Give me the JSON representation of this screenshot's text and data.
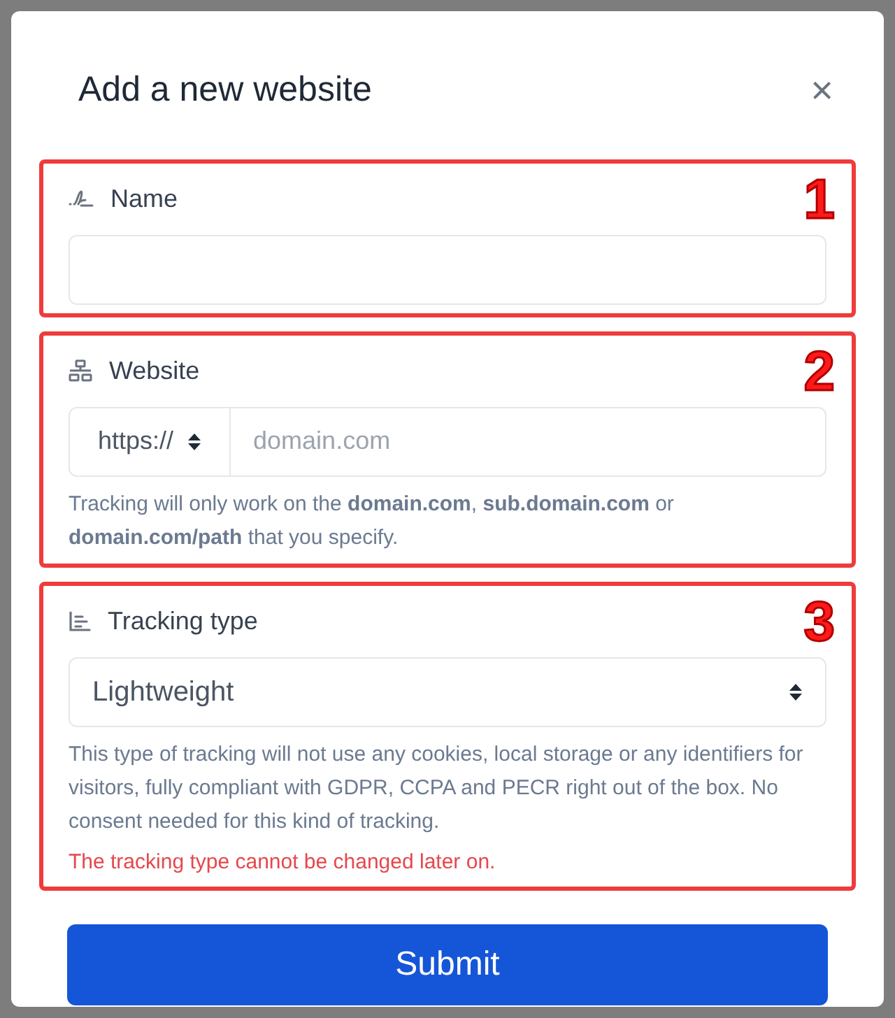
{
  "dialog": {
    "title": "Add a new website",
    "close": "×"
  },
  "sections": [
    {
      "number": "1",
      "kind": "text",
      "label": "Name"
    },
    {
      "number": "2",
      "kind": "url",
      "label": "Website",
      "protocol": "https://",
      "placeholder": "domain.com",
      "help": "Tracking will only work on the **domain.com**, **sub.domain.com** or **domain.com/path** that you specify."
    },
    {
      "number": "3",
      "kind": "select",
      "label": "Tracking type",
      "value": "Lightweight",
      "help": "This type of tracking will not use any cookies, local storage or any identifiers for visitors, fully compliant with GDPR, CCPA and PECR right out of the box. No consent needed for this kind of tracking.",
      "warning": "The tracking type cannot be changed later on."
    }
  ],
  "submit": "Submit"
}
